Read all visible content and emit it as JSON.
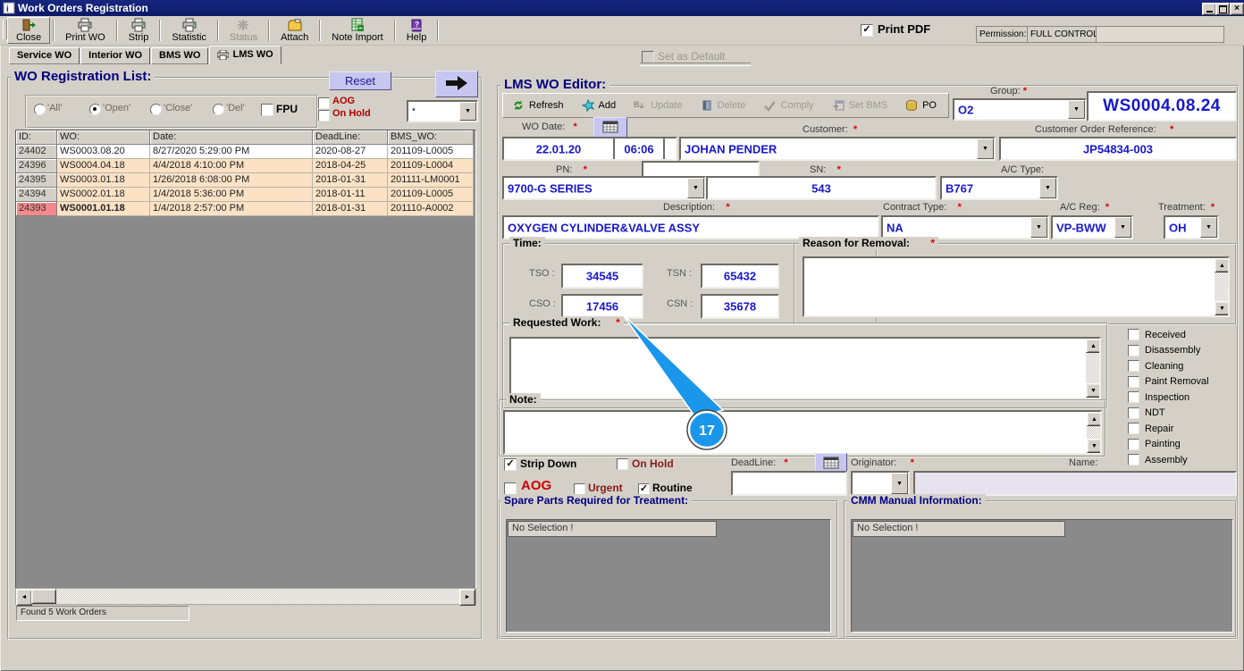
{
  "window": {
    "title": "Work Orders Registration",
    "controls": [
      "minimize",
      "restore",
      "close"
    ]
  },
  "ui": {
    "required_marker": "*"
  },
  "colors": {
    "title_bar": "#0f1f7c",
    "panel_bg": "#d4d0c8",
    "heading_navy": "#000080",
    "value_blue": "#1818cf",
    "required_red": "#e00000",
    "alert_red": "#b00000",
    "row_peach": "#fbe2c5",
    "row_alert": "#f4898c",
    "list_gray": "#8a8a8a",
    "button_lavender": "#c6c6f0",
    "callout_blue": "#1a97ea"
  },
  "toolbar": {
    "buttons": [
      {
        "label": "Close",
        "icon": "exit-icon",
        "disabled": false
      },
      {
        "label": "Print WO",
        "icon": "printer-icon",
        "disabled": false
      },
      {
        "label": "Strip",
        "icon": "printer-icon",
        "disabled": false
      },
      {
        "label": "Statistic",
        "icon": "printer-icon",
        "disabled": false
      },
      {
        "label": "Status",
        "icon": "status-icon",
        "disabled": true
      },
      {
        "label": "Attach",
        "icon": "attach-icon",
        "disabled": false
      },
      {
        "label": "Note Import",
        "icon": "note-import-icon",
        "disabled": false
      },
      {
        "label": "Help",
        "icon": "help-icon",
        "disabled": false
      }
    ],
    "print_pdf": {
      "label": "Print PDF",
      "checked": true
    },
    "permission_label": "Permission:",
    "permission_value": "FULL CONTROL"
  },
  "tabs": {
    "items": [
      "Service WO",
      "Interior WO",
      "BMS WO",
      "LMS WO"
    ],
    "active_index": 3,
    "set_as_default": {
      "label": "Set as Default",
      "checked": false,
      "disabled": true
    }
  },
  "wo_list": {
    "title": "WO Registration List:",
    "reset_label": "Reset",
    "filters": {
      "radios": [
        {
          "label": "'All'",
          "selected": false
        },
        {
          "label": "'Open'",
          "selected": true
        },
        {
          "label": "'Close'",
          "selected": false
        },
        {
          "label": "'Del'",
          "selected": false
        }
      ],
      "fpu": {
        "label": "FPU",
        "checked": false
      },
      "aog": {
        "label": "AOG",
        "checked": false
      },
      "on_hold": {
        "label": "On Hold",
        "checked": false
      },
      "search_value": "*"
    },
    "table": {
      "columns": [
        "ID:",
        "WO:",
        "Date:",
        "DeadLine:",
        "BMS_WO:"
      ],
      "rows": [
        {
          "id": "24402",
          "wo": "WS0003.08.20",
          "date": "8/27/2020 5:29:00 PM",
          "deadline": "2020-08-27",
          "bms_wo": "201109-L0005",
          "row_style": "white",
          "id_style": "gray",
          "wo_bold": false
        },
        {
          "id": "24396",
          "wo": "WS0004.04.18",
          "date": "4/4/2018 4:10:00 PM",
          "deadline": "2018-04-25",
          "bms_wo": "201109-L0004",
          "row_style": "peach",
          "id_style": "gray",
          "wo_bold": false
        },
        {
          "id": "24395",
          "wo": "WS0003.01.18",
          "date": "1/26/2018 6:08:00 PM",
          "deadline": "2018-01-31",
          "bms_wo": "201111-LM0001",
          "row_style": "peach",
          "id_style": "gray",
          "wo_bold": false
        },
        {
          "id": "24394",
          "wo": "WS0002.01.18",
          "date": "1/4/2018 5:36:00 PM",
          "deadline": "2018-01-11",
          "bms_wo": "201109-L0005",
          "row_style": "peach",
          "id_style": "gray",
          "wo_bold": false
        },
        {
          "id": "24393",
          "wo": "WS0001.01.18",
          "date": "1/4/2018 2:57:00 PM",
          "deadline": "2018-01-31",
          "bms_wo": "201110-A0002",
          "row_style": "peach",
          "id_style": "red",
          "wo_bold": true
        }
      ]
    },
    "status": "Found 5 Work Orders"
  },
  "editor": {
    "title": "LMS WO Editor:",
    "toolbar": [
      {
        "label": "Refresh",
        "icon": "refresh-icon",
        "disabled": false
      },
      {
        "label": "Add",
        "icon": "add-icon",
        "disabled": false
      },
      {
        "label": "Update",
        "icon": "update-icon",
        "disabled": true
      },
      {
        "label": "Delete",
        "icon": "delete-icon",
        "disabled": true
      },
      {
        "label": "Comply",
        "icon": "comply-icon",
        "disabled": true
      },
      {
        "label": "Set BMS",
        "icon": "set-bms-icon",
        "disabled": true
      },
      {
        "label": "PO",
        "icon": "po-icon",
        "disabled": false
      }
    ],
    "group": {
      "label": "Group:",
      "value": "O2"
    },
    "wo_number": "WS0004.08.24",
    "wo_date": {
      "label": "WO Date:",
      "date": "22.01.20",
      "time": "06:06"
    },
    "customer": {
      "label": "Customer:",
      "value": "JOHAN PENDER"
    },
    "customer_order_ref": {
      "label": "Customer Order Reference:",
      "value": "JP54834-003"
    },
    "pn": {
      "label": "PN:",
      "value": "9700-G SERIES",
      "extra_value": ""
    },
    "sn": {
      "label": "SN:",
      "value": "543"
    },
    "ac_type": {
      "label": "A/C Type:",
      "value": "B767"
    },
    "description": {
      "label": "Description:",
      "value": "OXYGEN CYLINDER&VALVE ASSY"
    },
    "contract_type": {
      "label": "Contract Type:",
      "value": "NA"
    },
    "ac_reg": {
      "label": "A/C Reg:",
      "value": "VP-BWW"
    },
    "treatment": {
      "label": "Treatment:",
      "value": "OH"
    },
    "time_group": {
      "label": "Time:",
      "tso_label": "TSO :",
      "tso": "34545",
      "tsn_label": "TSN :",
      "tsn": "65432",
      "cso_label": "CSO :",
      "cso": "17456",
      "csn_label": "CSN :",
      "csn": "35678"
    },
    "reason": {
      "label": "Reason for Removal:",
      "value": ""
    },
    "requested_work": {
      "label": "Requested Work:",
      "value": ""
    },
    "note": {
      "label": "Note:",
      "value": ""
    },
    "process_checkboxes": [
      {
        "label": "Received",
        "checked": false
      },
      {
        "label": "Disassembly",
        "checked": false
      },
      {
        "label": "Cleaning",
        "checked": false
      },
      {
        "label": "Paint Removal",
        "checked": false
      },
      {
        "label": "Inspection",
        "checked": false
      },
      {
        "label": "NDT",
        "checked": false
      },
      {
        "label": "Repair",
        "checked": false
      },
      {
        "label": "Painting",
        "checked": false
      },
      {
        "label": "Assembly",
        "checked": false
      }
    ],
    "strip_down": {
      "label": "Strip Down",
      "checked": true
    },
    "on_hold": {
      "label": "On Hold",
      "checked": false
    },
    "deadline": {
      "label": "DeadLine:",
      "value": ""
    },
    "originator": {
      "label": "Originator:",
      "value": ""
    },
    "name": {
      "label": "Name:",
      "value": ""
    },
    "aog": {
      "label": "AOG",
      "checked": false
    },
    "urgent": {
      "label": "Urgent",
      "checked": false
    },
    "routine": {
      "label": "Routine",
      "checked": true
    },
    "spare_parts": {
      "label": "Spare Parts Required for Treatment:",
      "empty_text": "No Selection !"
    },
    "cmm": {
      "label": "CMM Manual Information:",
      "empty_text": "No Selection !"
    }
  },
  "callout": {
    "number": "17"
  }
}
